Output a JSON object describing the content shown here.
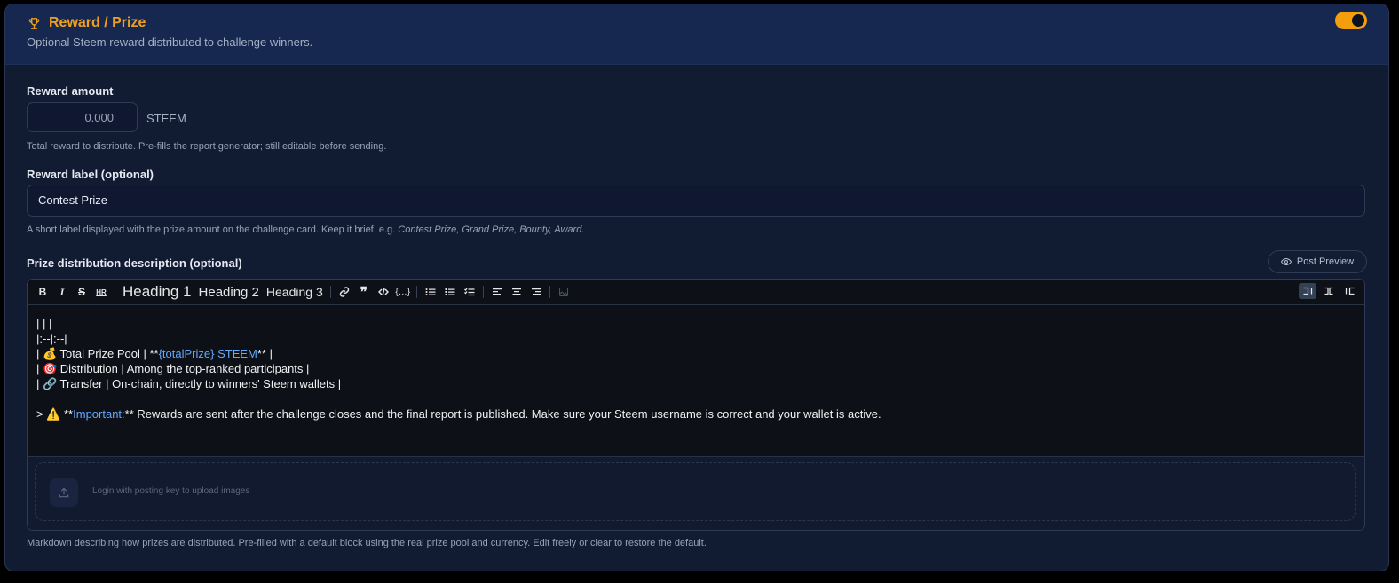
{
  "header": {
    "title": "Reward / Prize",
    "subtitle": "Optional Steem reward distributed to challenge winners.",
    "toggle_on": true,
    "accent": "#f59e0b"
  },
  "reward_amount": {
    "label": "Reward amount",
    "placeholder": "0.000",
    "unit": "STEEM",
    "help": "Total reward to distribute. Pre-fills the report generator; still editable before sending."
  },
  "reward_label": {
    "label": "Reward label (optional)",
    "value": "Contest Prize",
    "help_prefix": "A short label displayed with the prize amount on the challenge card. Keep it brief, e.g. ",
    "help_examples": "Contest Prize, Grand Prize, Bounty, Award."
  },
  "distribution": {
    "label": "Prize distribution description (optional)",
    "preview_button": "Post Preview",
    "toolbar": {
      "h1": "Heading 1",
      "h2": "Heading 2",
      "h3": "Heading 3"
    },
    "lines": {
      "l1": "| | |",
      "l2": "|:--|:--|",
      "l3_a": "| 💰 Total Prize Pool | **",
      "l3_b": "{totalPrize} STEEM",
      "l3_c": "** |",
      "l4": "| 🎯 Distribution | Among the top-ranked participants |",
      "l5": "| 🔗 Transfer | On-chain, directly to winners' Steem wallets |",
      "l6_a": "> ⚠️ **",
      "l6_b": "Important:",
      "l6_c": "** Rewards are sent after the challenge closes and the final report is published. Make sure your Steem username is correct and your wallet is active."
    },
    "upload_text": "Login with posting key to upload images",
    "help": "Markdown describing how prizes are distributed. Pre-filled with a default block using the real prize pool and currency. Edit freely or clear to restore the default."
  }
}
